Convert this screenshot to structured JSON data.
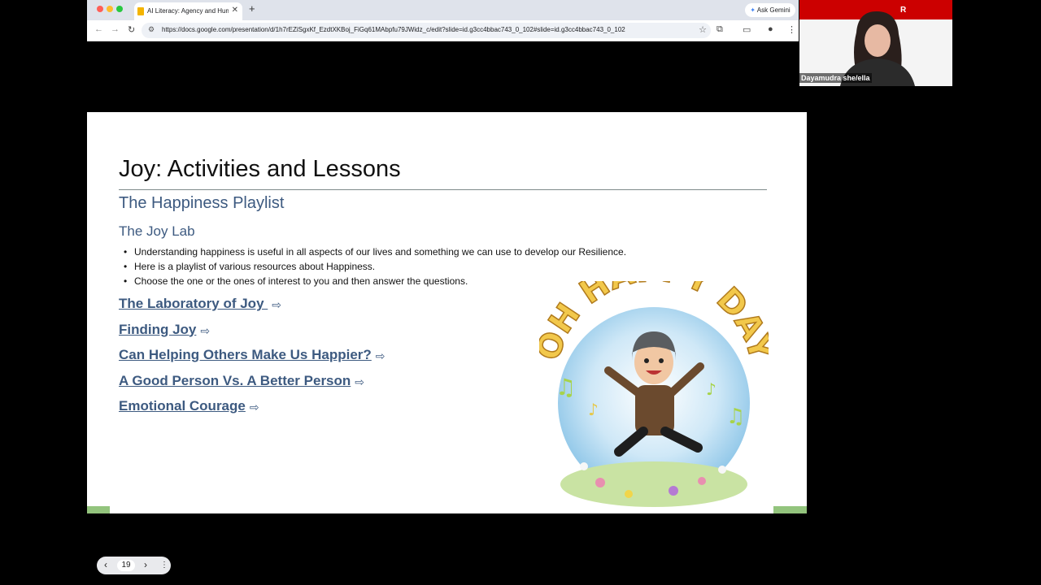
{
  "browser": {
    "tab_title": "AI Literacy: Agency and Hum",
    "tab_close": "✕",
    "new_tab": "+",
    "ask_gemini": "Ask Gemini",
    "url": "https://docs.google.com/presentation/d/1h7rEZiSgxKf_EzdtXKBoj_FiGq61MAbpfu79JWidz_c/edit?slide=id.g3cc4bbac743_0_102#slide=id.g3cc4bbac743_0_102"
  },
  "slide": {
    "title": "Joy: Activities and Lessons",
    "subtitle": "The Happiness Playlist",
    "section": "The Joy Lab",
    "bullets": [
      "Understanding happiness is useful in all aspects of our lives and something we can use to develop our Resilience.",
      "Here is a playlist of various resources about Happiness.",
      "Choose the one or the ones of interest to you and then answer the questions."
    ],
    "links": [
      "The Laboratory of Joy ",
      "Finding Joy",
      "Can Helping Others Make Us Happier?",
      "A Good Person Vs. A Better Person",
      "Emotional Courage"
    ],
    "art_text": "OH HAPPY DAY"
  },
  "pager": {
    "page": "19",
    "prev": "‹",
    "next": "›",
    "more": "⋮"
  },
  "webcam": {
    "name": "Dayamudra she/ella",
    "logo": "R"
  },
  "colors": {
    "link": "#3d5a80",
    "accent_green": "#93c47d",
    "banner_red": "#cc0000"
  }
}
